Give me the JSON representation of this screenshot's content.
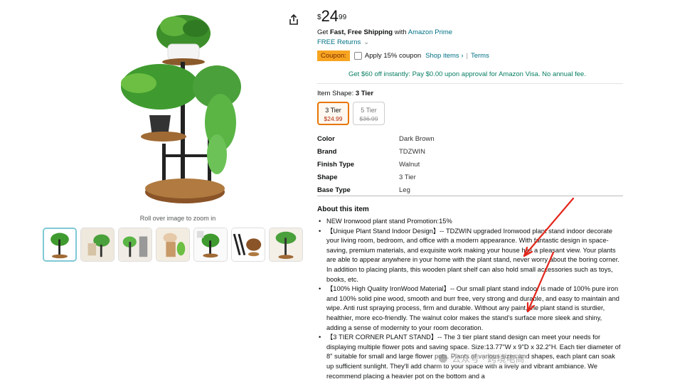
{
  "product": {
    "price": {
      "symbol": "$",
      "whole": "24",
      "fraction": "99"
    },
    "zoom_hint": "Roll over image to zoom in",
    "thumbnails": [
      "thumb-1",
      "thumb-2",
      "thumb-3",
      "thumb-4",
      "thumb-5",
      "thumb-6",
      "thumb-7"
    ]
  },
  "shipping": {
    "prefix": "Get ",
    "bold": "Fast, Free Shipping",
    "with": " with ",
    "prime": "Amazon Prime",
    "returns": "FREE Returns",
    "returns_chevron": "⌄"
  },
  "coupon": {
    "badge": "Coupon:",
    "apply": "Apply 15% coupon",
    "shop_items": "Shop items ›",
    "separator": "|",
    "terms": "Terms"
  },
  "visa_offer": "Get $60 off instantly: Pay $0.00 upon approval for Amazon Visa. No annual fee.",
  "item_shape": {
    "label": "Item Shape: ",
    "selected": "3 Tier",
    "options": [
      {
        "name": "3 Tier",
        "price": "$24.99"
      },
      {
        "name": "5 Tier",
        "price": "$36.99"
      }
    ]
  },
  "specs": [
    {
      "key": "Color",
      "value": "Dark Brown"
    },
    {
      "key": "Brand",
      "value": "TDZWIN"
    },
    {
      "key": "Finish Type",
      "value": "Walnut"
    },
    {
      "key": "Shape",
      "value": "3 Tier"
    },
    {
      "key": "Base Type",
      "value": "Leg"
    }
  ],
  "about": {
    "title": "About this item",
    "bullets": [
      "NEW Ironwood plant stand Promotion:15%",
      "【Unique Plant Stand Indoor Design】-- TDZWIN upgraded Ironwood plant stand indoor decorate your living room, bedroom, and office with a modern appearance. With fantastic design in space-saving, premium materials, and exquisite work making your house has a pleasant view. Your plants are able to appear anywhere in your home with the plant stand, never worry about the boring corner. In addition to placing plants, this wooden plant shelf can also hold small accessories such as toys, books, etc.",
      "【100% High Quality IronWood Material】-- Our small plant stand indoor is made of 100% pure iron and 100% solid pine wood, smooth and burr free, very strong and durable, and easy to maintain and wipe. Anti rust spraying process, firm and durable. Without any paint, the plant stand is sturdier, healthier, more eco-friendly. The walnut color makes the stand's surface more sleek and shiny, adding a sense of modernity to your room decoration.",
      "【3 TIER CORNER PLANT STAND】-- The 3 tier plant stand design can meet your needs for displaying multiple flower pots and saving space. Size:13.77\"W x 9\"D x 32.2\"H. Each tier diameter of 8\" suitable for small and large flower pots. Plants of various sizes and shapes, each plant can soak up sufficient sunlight. They'll add charm to your space with a lively and vibrant ambiance. We recommend placing a heavier pot on the bottom and a"
    ]
  },
  "watermark": "公众号 · 跨境电商"
}
